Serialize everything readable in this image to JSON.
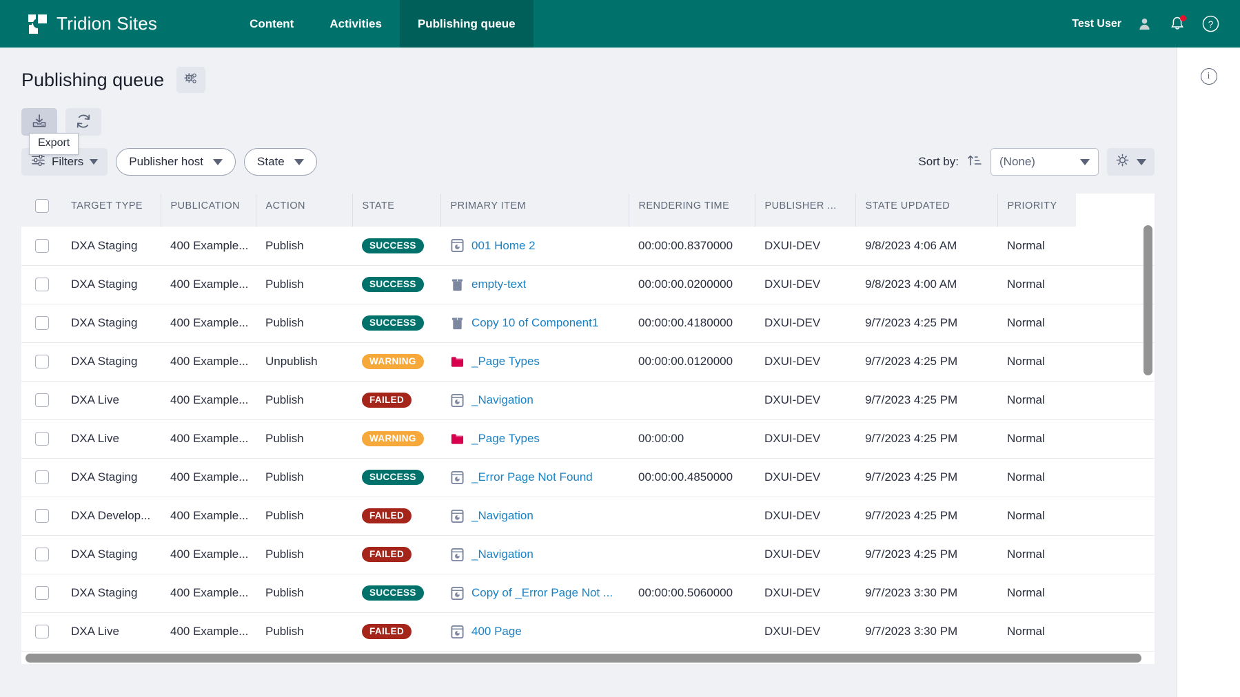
{
  "topbar": {
    "brand": "Tridion Sites",
    "nav": [
      {
        "label": "Content",
        "active": false
      },
      {
        "label": "Activities",
        "active": false
      },
      {
        "label": "Publishing queue",
        "active": true
      }
    ],
    "user_name": "Test User",
    "icons": [
      "user-icon",
      "notifications-bell-icon",
      "help-icon"
    ],
    "accent_color": "#00726b",
    "accent_active_color": "#005f59",
    "notification_dot_color": "#e8112d"
  },
  "page": {
    "title": "Publishing queue",
    "settings_button_icon": "gears-settings-icon"
  },
  "toolbar": {
    "export_icon": "export-download-icon",
    "refresh_icon": "refresh-icon",
    "tooltip": "Export"
  },
  "filters": {
    "filters_label": "Filters",
    "filters_icon": "filter-sliders-icon",
    "pills": [
      {
        "label": "Publisher host"
      },
      {
        "label": "State"
      }
    ],
    "sort_label": "Sort by:",
    "sort_icon": "sort-ascending-icon",
    "sort_value": "(None)",
    "column-settings-icon": "gear-icon"
  },
  "table": {
    "columns": [
      "TARGET TYPE",
      "PUBLICATION",
      "ACTION",
      "STATE",
      "PRIMARY ITEM",
      "RENDERING TIME",
      "PUBLISHER ...",
      "STATE UPDATED",
      "PRIORITY"
    ],
    "state_colors": {
      "SUCCESS": "#00726b",
      "WARNING": "#f7a83b",
      "FAILED": "#a5251a"
    },
    "rows": [
      {
        "target_type": "DXA Staging",
        "publication": "400 Example...",
        "action": "Publish",
        "state": "SUCCESS",
        "primary_item": "001 Home 2",
        "item_icon": "page-icon",
        "rendering_time": "00:00:00.8370000",
        "publisher": "DXUI-DEV",
        "state_updated": "9/8/2023 4:06 AM",
        "priority": "Normal"
      },
      {
        "target_type": "DXA Staging",
        "publication": "400 Example...",
        "action": "Publish",
        "state": "SUCCESS",
        "primary_item": "empty-text",
        "item_icon": "component-icon",
        "rendering_time": "00:00:00.0200000",
        "publisher": "DXUI-DEV",
        "state_updated": "9/8/2023 4:00 AM",
        "priority": "Normal"
      },
      {
        "target_type": "DXA Staging",
        "publication": "400 Example...",
        "action": "Publish",
        "state": "SUCCESS",
        "primary_item": "Copy 10 of Component1",
        "item_icon": "component-icon",
        "rendering_time": "00:00:00.4180000",
        "publisher": "DXUI-DEV",
        "state_updated": "9/7/2023 4:25 PM",
        "priority": "Normal"
      },
      {
        "target_type": "DXA Staging",
        "publication": "400 Example...",
        "action": "Unpublish",
        "state": "WARNING",
        "primary_item": "_Page Types",
        "item_icon": "folder-icon",
        "rendering_time": "00:00:00.0120000",
        "publisher": "DXUI-DEV",
        "state_updated": "9/7/2023 4:25 PM",
        "priority": "Normal"
      },
      {
        "target_type": "DXA Live",
        "publication": "400 Example...",
        "action": "Publish",
        "state": "FAILED",
        "primary_item": "_Navigation",
        "item_icon": "page-icon",
        "rendering_time": "",
        "publisher": "DXUI-DEV",
        "state_updated": "9/7/2023 4:25 PM",
        "priority": "Normal"
      },
      {
        "target_type": "DXA Live",
        "publication": "400 Example...",
        "action": "Publish",
        "state": "WARNING",
        "primary_item": "_Page Types",
        "item_icon": "folder-icon",
        "rendering_time": "00:00:00",
        "publisher": "DXUI-DEV",
        "state_updated": "9/7/2023 4:25 PM",
        "priority": "Normal"
      },
      {
        "target_type": "DXA Staging",
        "publication": "400 Example...",
        "action": "Publish",
        "state": "SUCCESS",
        "primary_item": "_Error Page Not Found",
        "item_icon": "page-icon",
        "rendering_time": "00:00:00.4850000",
        "publisher": "DXUI-DEV",
        "state_updated": "9/7/2023 4:25 PM",
        "priority": "Normal"
      },
      {
        "target_type": "DXA Develop...",
        "publication": "400 Example...",
        "action": "Publish",
        "state": "FAILED",
        "primary_item": "_Navigation",
        "item_icon": "page-icon",
        "rendering_time": "",
        "publisher": "DXUI-DEV",
        "state_updated": "9/7/2023 4:25 PM",
        "priority": "Normal"
      },
      {
        "target_type": "DXA Staging",
        "publication": "400 Example...",
        "action": "Publish",
        "state": "FAILED",
        "primary_item": "_Navigation",
        "item_icon": "page-icon",
        "rendering_time": "",
        "publisher": "DXUI-DEV",
        "state_updated": "9/7/2023 4:25 PM",
        "priority": "Normal"
      },
      {
        "target_type": "DXA Staging",
        "publication": "400 Example...",
        "action": "Publish",
        "state": "SUCCESS",
        "primary_item": "Copy of _Error Page Not ...",
        "item_icon": "page-icon",
        "rendering_time": "00:00:00.5060000",
        "publisher": "DXUI-DEV",
        "state_updated": "9/7/2023 3:30 PM",
        "priority": "Normal"
      },
      {
        "target_type": "DXA Live",
        "publication": "400 Example...",
        "action": "Publish",
        "state": "FAILED",
        "primary_item": "400 Page",
        "item_icon": "page-icon",
        "rendering_time": "",
        "publisher": "DXUI-DEV",
        "state_updated": "9/7/2023 3:30 PM",
        "priority": "Normal"
      }
    ]
  },
  "side_panel": {
    "info_icon": "info-icon",
    "info_glyph": "i"
  }
}
